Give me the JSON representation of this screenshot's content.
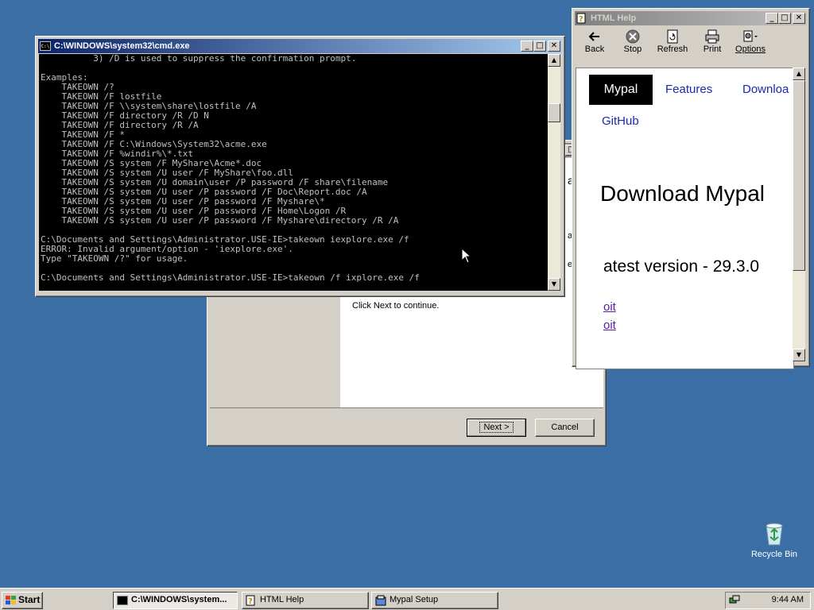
{
  "cmd": {
    "title": "C:\\WINDOWS\\system32\\cmd.exe",
    "output": "          3) /D is used to suppress the confirmation prompt.\n\nExamples:\n    TAKEOWN /?\n    TAKEOWN /F lostfile\n    TAKEOWN /F \\\\system\\share\\lostfile /A\n    TAKEOWN /F directory /R /D N\n    TAKEOWN /F directory /R /A\n    TAKEOWN /F *\n    TAKEOWN /F C:\\Windows\\System32\\acme.exe\n    TAKEOWN /F %windir%\\*.txt\n    TAKEOWN /S system /F MyShare\\Acme*.doc\n    TAKEOWN /S system /U user /F MyShare\\foo.dll\n    TAKEOWN /S system /U domain\\user /P password /F share\\filename\n    TAKEOWN /S system /U user /P password /F Doc\\Report.doc /A\n    TAKEOWN /S system /U user /P password /F Myshare\\*\n    TAKEOWN /S system /U user /P password /F Home\\Logon /R\n    TAKEOWN /S system /U user /P password /F Myshare\\directory /R /A\n\nC:\\Documents and Settings\\Administrator.USE-IE>takeown iexplore.exe /f\nERROR: Invalid argument/option - 'iexplore.exe'.\nType \"TAKEOWN /?\" for usage.\n\nC:\\Documents and Settings\\Administrator.USE-IE>takeown /f ixplore.exe /f"
  },
  "help": {
    "title": "HTML Help",
    "toolbar": {
      "back": "Back",
      "stop": "Stop",
      "refresh": "Refresh",
      "print": "Print",
      "options": "Options"
    },
    "nav": {
      "mypal": "Mypal",
      "features": "Features",
      "download": "Downloa",
      "github": "GitHub"
    },
    "heading": "Download Mypal",
    "version": "atest version - 29.3.0",
    "link1": "oit",
    "link2": "oit"
  },
  "setup": {
    "frag_ard": "ard",
    "frag_al": "al.",
    "frag_e": "e",
    "continue_text": "Click Next to continue.",
    "next_label": "Next >",
    "cancel_label": "Cancel"
  },
  "taskbar": {
    "start": "Start",
    "tasks": [
      "C:\\WINDOWS\\system...",
      "HTML Help",
      "Mypal Setup"
    ],
    "clock": "9:44 AM"
  },
  "desktop": {
    "recycle_bin": "Recycle Bin"
  },
  "colors": {
    "desktop": "#3a6ea5",
    "titlebar_active": "#0a246a",
    "link": "#1a2aa8"
  }
}
